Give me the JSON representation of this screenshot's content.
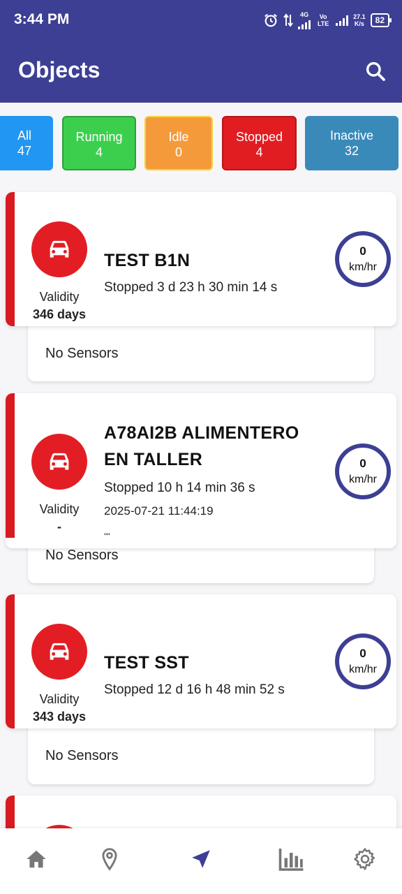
{
  "status_bar": {
    "time": "3:44 PM",
    "network": "4G",
    "volte": "Vo LTE",
    "speed": "27.1",
    "speed_unit": "K/s",
    "battery": "82"
  },
  "header": {
    "title": "Objects",
    "search_icon": "search-icon"
  },
  "filters": [
    {
      "label": "All",
      "count": "47",
      "color": "#2196f3"
    },
    {
      "label": "Running",
      "count": "4",
      "color": "#3ccf4e"
    },
    {
      "label": "Idle",
      "count": "0",
      "color": "#f59a3b"
    },
    {
      "label": "Stopped",
      "count": "4",
      "color": "#e11d22"
    },
    {
      "label": "Inactive",
      "count": "32",
      "color": "#3a8ab9"
    }
  ],
  "vehicles": [
    {
      "name": "TEST B1N",
      "status": "Stopped 3 d 23 h 30 min 14 s",
      "validity_label": "Validity",
      "validity": "346 days",
      "speed": "0",
      "speed_unit": "km/hr",
      "sensors": "No Sensors"
    },
    {
      "name_line1": "A78AI2B ALIMENTERO",
      "name_line2": "EN TALLER",
      "status": "Stopped 10 h 14 min 36 s",
      "date": "2025-07-21 11:44:19",
      "quote": "\"\"",
      "validity_label": "Validity",
      "validity": "-",
      "speed": "0",
      "speed_unit": "km/hr",
      "sensors": "No Sensors"
    },
    {
      "name": "TEST SST",
      "status": "Stopped 12 d 16 h 48 min 52 s",
      "validity_label": "Validity",
      "validity": "343 days",
      "speed": "0",
      "speed_unit": "km/hr",
      "sensors": "No Sensors"
    }
  ],
  "colors": {
    "primary": "#3d3f94",
    "stopped": "#d81b21"
  },
  "bottom_nav": [
    "home-icon",
    "location-pin-icon",
    "navigation-arrow-icon",
    "bar-chart-icon",
    "settings-gear-icon"
  ]
}
